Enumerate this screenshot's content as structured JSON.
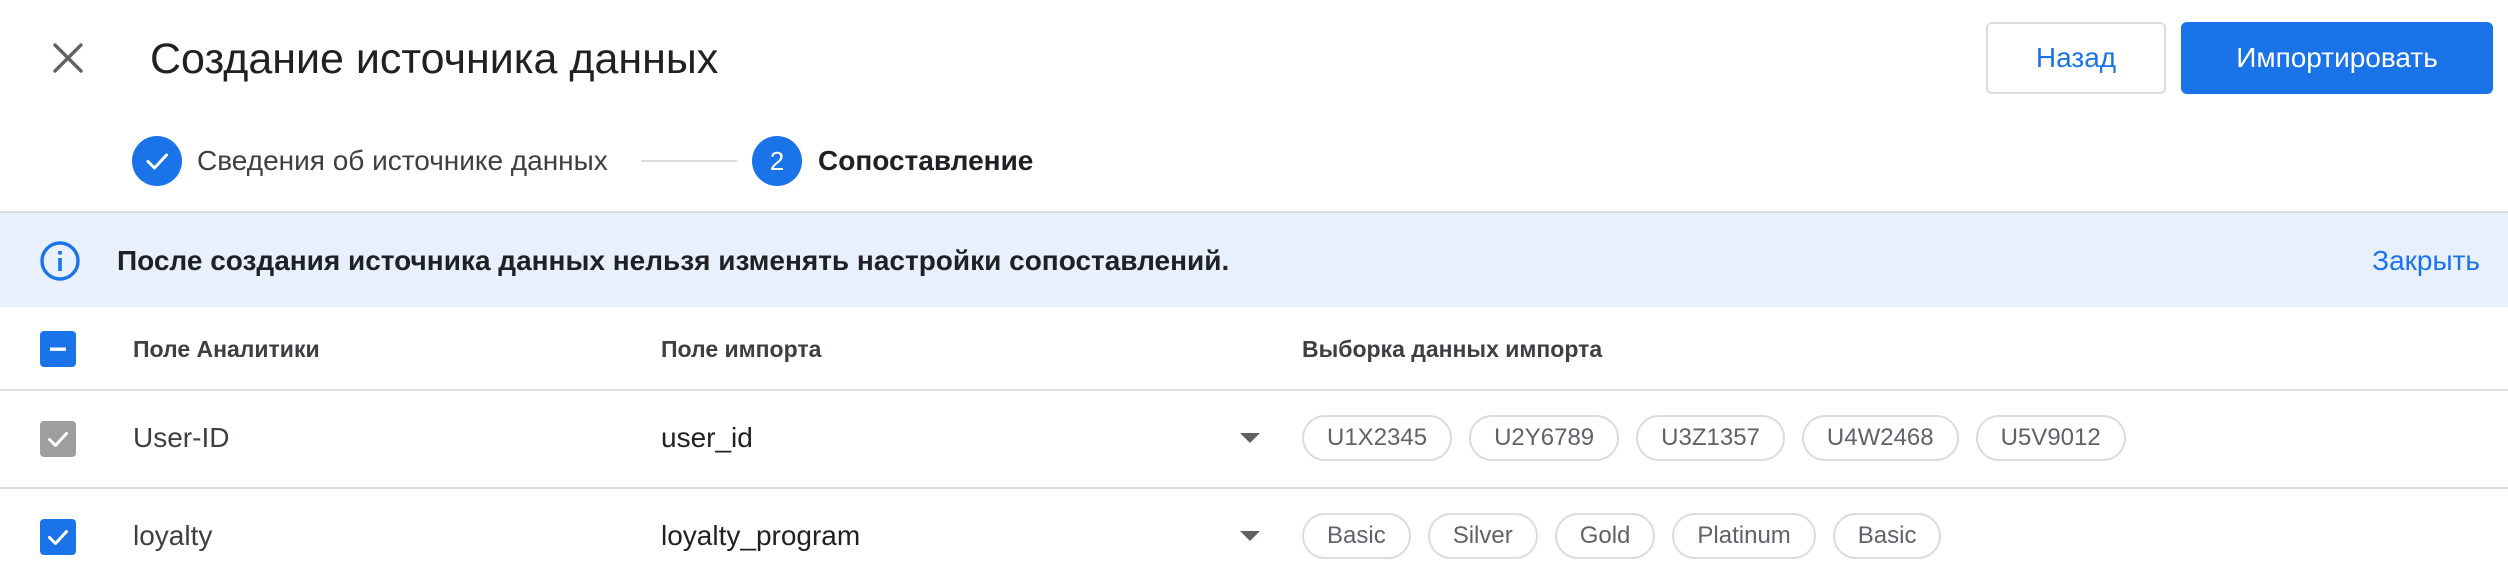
{
  "header": {
    "title": "Создание источника данных",
    "back_label": "Назад",
    "import_label": "Импортировать"
  },
  "stepper": {
    "step1_label": "Сведения об источнике данных",
    "step2_number": "2",
    "step2_label": "Сопоставление"
  },
  "banner": {
    "text": "После создания источника данных нельзя изменять настройки сопоставлений.",
    "close_label": "Закрыть"
  },
  "table": {
    "headers": {
      "analytics_field": "Поле Аналитики",
      "import_field": "Поле импорта",
      "import_sample": "Выборка данных импорта"
    },
    "rows": [
      {
        "field": "User-ID",
        "import_field": "user_id",
        "samples": [
          "U1X2345",
          "U2Y6789",
          "U3Z1357",
          "U4W2468",
          "U5V9012"
        ]
      },
      {
        "field": "loyalty",
        "import_field": "loyalty_program",
        "samples": [
          "Basic",
          "Silver",
          "Gold",
          "Platinum",
          "Basic"
        ]
      }
    ]
  }
}
